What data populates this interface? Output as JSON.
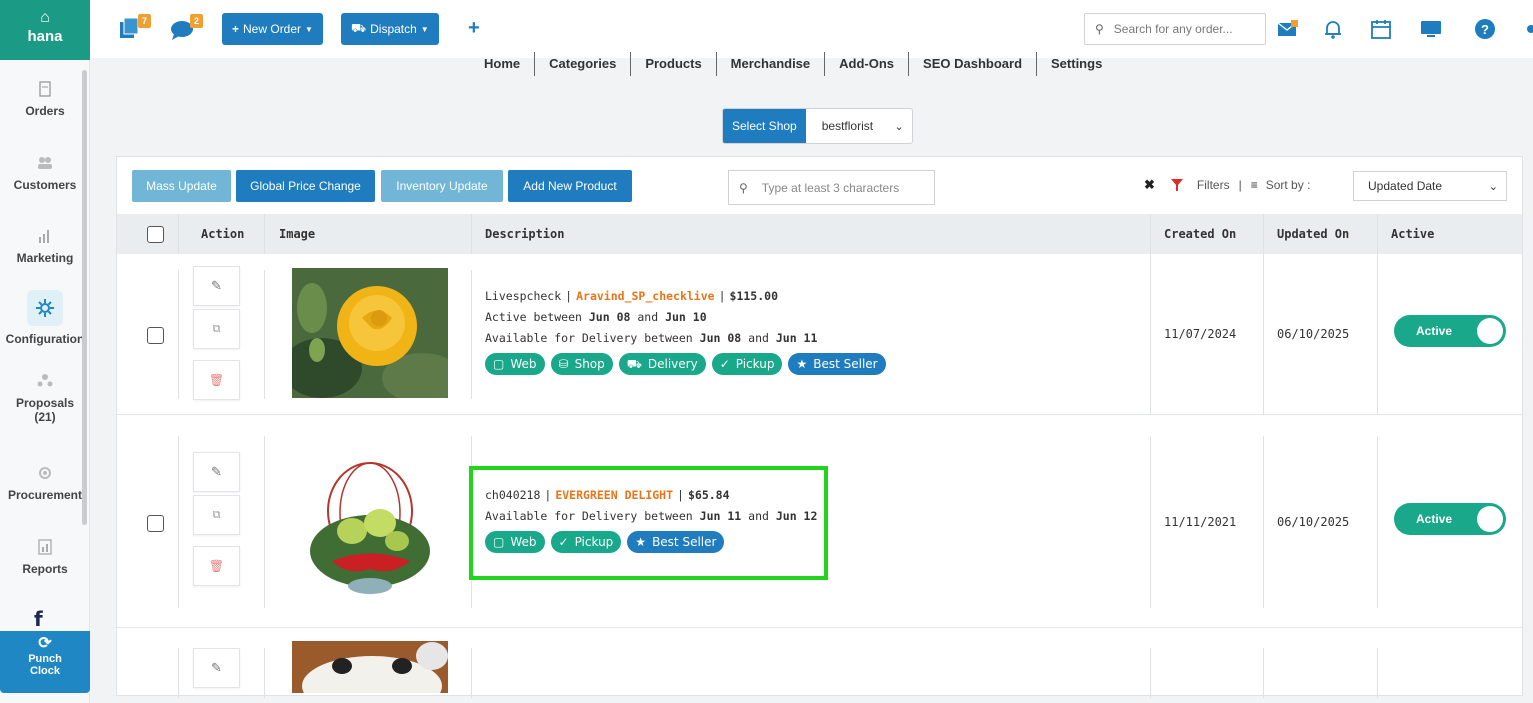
{
  "app": {
    "brand": "hana"
  },
  "sidebar": {
    "items": [
      {
        "label": "Orders",
        "icon": "orders-icon"
      },
      {
        "label": "Customers",
        "icon": "customers-icon"
      },
      {
        "label": "Marketing",
        "icon": "marketing-icon"
      },
      {
        "label": "Configuration",
        "icon": "configuration-icon",
        "active": true
      },
      {
        "label": "Proposals",
        "count": "(21)",
        "icon": "proposals-icon"
      },
      {
        "label": "Procurement",
        "icon": "procurement-icon"
      },
      {
        "label": "Reports",
        "icon": "reports-icon"
      }
    ],
    "punch_clock": {
      "line1": "Punch",
      "line2": "Clock"
    },
    "facebook": "f"
  },
  "topbar": {
    "orders_badge": "7",
    "messages_badge": "2",
    "new_order": "New Order",
    "dispatch": "Dispatch",
    "add": "+",
    "search_placeholder": "Search for any order..."
  },
  "nav_tabs": [
    "Home",
    "Categories",
    "Products",
    "Merchandise",
    "Add-Ons",
    "SEO Dashboard",
    "Settings"
  ],
  "shop": {
    "label": "Select Shop",
    "value": "bestflorist"
  },
  "toolbar": {
    "mass_update": "Mass Update",
    "global_price_change": "Global Price Change",
    "inventory_update": "Inventory Update",
    "add_new_product": "Add New Product",
    "search_placeholder": "Type at least 3 characters",
    "filters": "Filters",
    "sort_by": "Sort by :",
    "sort_value": "Updated Date"
  },
  "table": {
    "headers": {
      "action": "Action",
      "image": "Image",
      "description": "Description",
      "created": "Created On",
      "updated": "Updated On",
      "active": "Active"
    },
    "rows": [
      {
        "code": "Livespcheck",
        "name": "Aravind_SP_checklive",
        "price": "$115.00",
        "active_prefix": "Active between",
        "active_from": "Jun 08",
        "and1": "and",
        "active_to": "Jun 10",
        "delivery_prefix": "Available for Delivery between",
        "delivery_from": "Jun 08",
        "and2": "and",
        "delivery_to": "Jun 11",
        "tags": {
          "web": "Web",
          "shop": "Shop",
          "delivery": "Delivery",
          "pickup": "Pickup",
          "best_seller": "Best Seller"
        },
        "created": "11/07/2024",
        "updated": "06/10/2025",
        "status": "Active"
      },
      {
        "code": "ch040218",
        "name": "EVERGREEN DELIGHT",
        "price": "$65.84",
        "delivery_prefix": "Available for Delivery between",
        "delivery_from": "Jun 11",
        "and2": "and",
        "delivery_to": "Jun 12",
        "tags": {
          "web": "Web",
          "pickup": "Pickup",
          "best_seller": "Best Seller"
        },
        "created": "11/11/2021",
        "updated": "06/10/2025",
        "status": "Active"
      }
    ]
  },
  "colors": {
    "brand": "#1b9a85",
    "primary": "#1f7dbf",
    "green_tag": "#19a88a",
    "highlight": "#22d41c",
    "accent_name": "#e8751a"
  }
}
